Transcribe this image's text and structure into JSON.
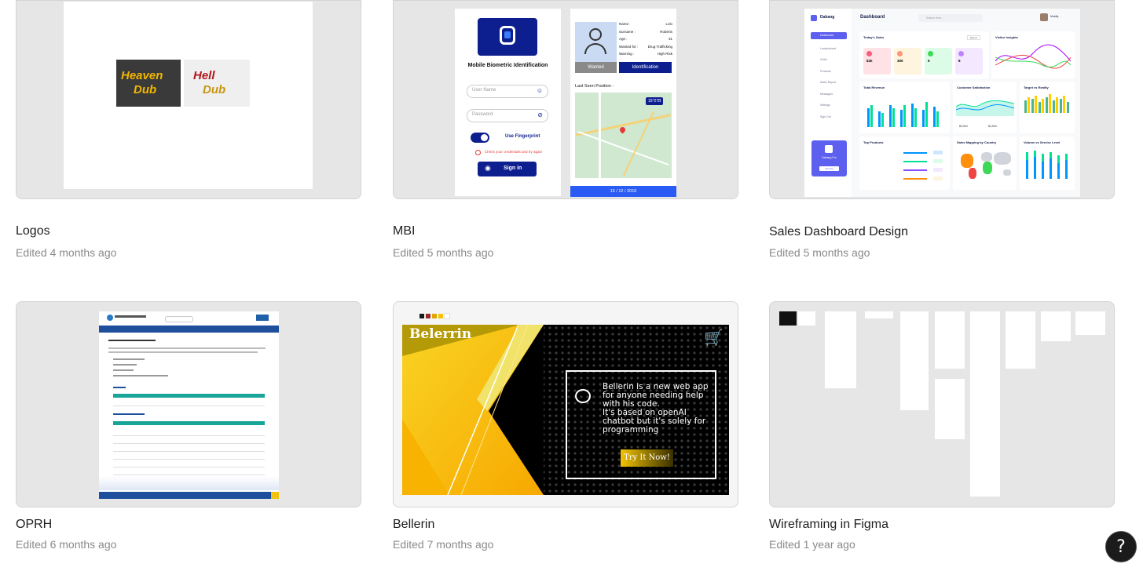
{
  "files": [
    {
      "title": "Logos",
      "edited": "Edited 4 months ago",
      "thumb": {
        "logo1_line1": "Heaven",
        "logo1_line2": "Dub",
        "logo2_line1": "Hell",
        "logo2_line2": "Dub"
      }
    },
    {
      "title": "MBI",
      "edited": "Edited 5 months ago",
      "thumb": {
        "heading": "Mobile Biometric Identification",
        "username_placeholder": "User Name",
        "password_placeholder": "Password",
        "fingerprint_label": "Use Fingerprint",
        "error_text": "Check your credentials and try again",
        "signin_label": "Sign in",
        "field_labels": [
          "Name :",
          "Surname :",
          "Age :",
          "Wanted for :",
          "Warning :"
        ],
        "field_values": [
          "Lolo",
          "Roberts",
          "31",
          "Drug Trafficking",
          "High Risk"
        ],
        "wanted_label": "Wanted",
        "identification_label": "Identification",
        "last_seen_label": "Last Seen Position :",
        "map_badge": "15°27B",
        "date": "15 / 12 / 2016"
      }
    },
    {
      "title": "Sales Dashboard Design",
      "edited": "Edited 5 months ago",
      "thumb": {
        "brand": "Dabang",
        "heading": "Dashboard",
        "search_placeholder": "Search here...",
        "user_name": "Musfiq",
        "nav": [
          "Dashboard",
          "Leaderboard",
          "Order",
          "Products",
          "Sales Report",
          "Messages",
          "Settings",
          "Sign Out"
        ],
        "today_sales": "Today's Sales",
        "stats": [
          "$1k",
          "300",
          "5",
          "8"
        ],
        "visitor_insights": "Visitor Insights",
        "total_revenue": "Total Revenue",
        "customer_satisfaction": "Customer Satisfaction",
        "target_vs_reality": "Target vs Reality",
        "top_products": "Top Products",
        "sales_mapping": "Sales Mapping by Country",
        "volume_vs_service": "Volume vs Service Level",
        "pro_label": "Dabang Pro",
        "get_pro": "Get Pro",
        "export": "Export",
        "satisfaction_values": [
          "$3,004",
          "$4,504"
        ]
      }
    },
    {
      "title": "OPRH",
      "edited": "Edited 6 months ago",
      "thumb": {}
    },
    {
      "title": "Bellerin",
      "edited": "Edited 7 months ago",
      "thumb": {
        "brand": "Belerrin",
        "desc_lines": [
          "Bellerin is a new web app",
          "for anyone needing help",
          "with his code.",
          "It's based on openAI",
          "chatbot but it's solely for",
          "programming"
        ],
        "cta": "Try It Now!",
        "swatches": [
          "#1a1a1a",
          "#9a2a2a",
          "#e2a400",
          "#f5c400",
          "#ffffff"
        ]
      }
    },
    {
      "title": "Wireframing in Figma",
      "edited": "Edited 1 year ago",
      "thumb": {}
    }
  ],
  "help_label": "?"
}
